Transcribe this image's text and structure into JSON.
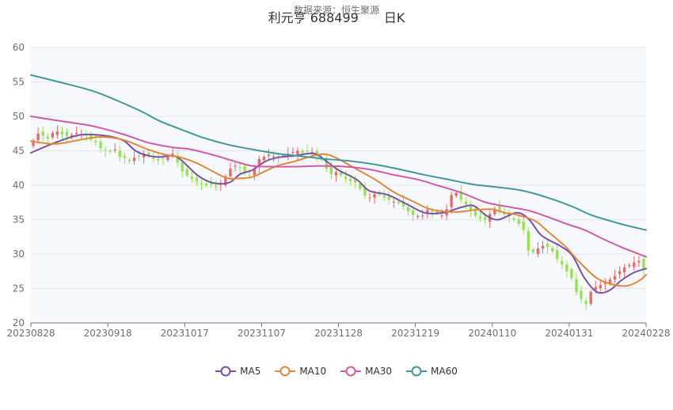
{
  "title": {
    "sub": "数据来源：恒生聚源",
    "main": "利元亨 688499　　日K"
  },
  "colors": {
    "up": "#ee6666",
    "down": "#91e54a",
    "MA5": "#7953a9",
    "MA10": "#e3873a",
    "MA30": "#d459a8",
    "MA60": "#3f9a9b",
    "plotBg": "#f7f8fc",
    "grid": "#e2e6ef"
  },
  "chart_data": {
    "type": "candlestick",
    "ylim": [
      20,
      60
    ],
    "yticks": [
      20,
      25,
      30,
      35,
      40,
      45,
      50,
      55,
      60
    ],
    "xticks": [
      "20230828",
      "20230918",
      "20231017",
      "20231107",
      "20231128",
      "20231219",
      "20240110",
      "20240131",
      "20240228"
    ],
    "x_range": [
      "20230828",
      "20240228"
    ],
    "closes": [
      46.5,
      47.5,
      47.2,
      46.8,
      47.6,
      47.8,
      47.4,
      47.1,
      47.3,
      47.6,
      47.4,
      47.2,
      46.6,
      46.2,
      45.4,
      45.0,
      44.9,
      45.2,
      44.1,
      44.0,
      43.5,
      44.0,
      44.2,
      44.6,
      44.3,
      43.8,
      43.6,
      43.8,
      44.3,
      44.6,
      43.3,
      42.0,
      41.4,
      40.9,
      40.6,
      40.2,
      40.0,
      40.1,
      39.9,
      40.3,
      41.3,
      42.4,
      42.8,
      42.6,
      41.8,
      41.4,
      42.3,
      43.8,
      44.1,
      44.4,
      44.2,
      44.0,
      44.3,
      44.6,
      44.8,
      45.0,
      44.7,
      44.9,
      44.8,
      44.4,
      43.7,
      42.4,
      41.6,
      41.9,
      41.5,
      40.9,
      40.6,
      40.4,
      39.5,
      38.5,
      38.2,
      38.7,
      38.6,
      38.2,
      37.9,
      37.6,
      37.4,
      36.9,
      36.2,
      35.7,
      35.5,
      35.6,
      36.4,
      36.1,
      35.9,
      35.6,
      36.5,
      38.6,
      38.9,
      37.9,
      37.2,
      36.3,
      35.6,
      35.2,
      35.0,
      35.8,
      36.6,
      36.2,
      35.8,
      35.5,
      35.0,
      34.4,
      33.5,
      30.5,
      30.3,
      30.8,
      31.2,
      31.0,
      30.4,
      29.3,
      28.5,
      27.5,
      26.5,
      24.5,
      23.5,
      22.8,
      24.5,
      25.2,
      25.5,
      26.0,
      26.3,
      26.8,
      27.5,
      28.1,
      28.4,
      28.8,
      29.0,
      27.8
    ],
    "series": [
      {
        "name": "MA5",
        "values": [
          [
            0,
            44.7
          ],
          [
            0.04,
            46.2
          ],
          [
            0.08,
            47.3
          ],
          [
            0.12,
            47.2
          ],
          [
            0.15,
            46.5
          ],
          [
            0.17,
            45.0
          ],
          [
            0.19,
            44.3
          ],
          [
            0.21,
            44.1
          ],
          [
            0.23,
            44.3
          ],
          [
            0.245,
            43.6
          ],
          [
            0.27,
            41.5
          ],
          [
            0.29,
            40.5
          ],
          [
            0.31,
            40.2
          ],
          [
            0.325,
            40.5
          ],
          [
            0.34,
            41.6
          ],
          [
            0.36,
            42.2
          ],
          [
            0.38,
            43.4
          ],
          [
            0.4,
            44.0
          ],
          [
            0.43,
            44.3
          ],
          [
            0.46,
            44.6
          ],
          [
            0.48,
            43.5
          ],
          [
            0.5,
            42.2
          ],
          [
            0.53,
            40.8
          ],
          [
            0.55,
            39.2
          ],
          [
            0.58,
            38.6
          ],
          [
            0.61,
            37.3
          ],
          [
            0.64,
            36.0
          ],
          [
            0.67,
            36.0
          ],
          [
            0.7,
            36.8
          ],
          [
            0.72,
            37.0
          ],
          [
            0.74,
            35.6
          ],
          [
            0.76,
            35.0
          ],
          [
            0.79,
            36.0
          ],
          [
            0.81,
            35.0
          ],
          [
            0.83,
            32.7
          ],
          [
            0.86,
            31.2
          ],
          [
            0.88,
            29.8
          ],
          [
            0.9,
            26.5
          ],
          [
            0.92,
            24.5
          ],
          [
            0.94,
            24.7
          ],
          [
            0.96,
            26.2
          ],
          [
            0.98,
            27.3
          ],
          [
            1.0,
            27.9
          ]
        ]
      },
      {
        "name": "MA10",
        "values": [
          [
            0,
            46.4
          ],
          [
            0.04,
            46.0
          ],
          [
            0.08,
            46.6
          ],
          [
            0.11,
            47.0
          ],
          [
            0.14,
            46.8
          ],
          [
            0.16,
            46.3
          ],
          [
            0.19,
            45.2
          ],
          [
            0.22,
            44.4
          ],
          [
            0.245,
            44.0
          ],
          [
            0.27,
            43.2
          ],
          [
            0.3,
            41.8
          ],
          [
            0.32,
            41.0
          ],
          [
            0.34,
            41.0
          ],
          [
            0.36,
            41.2
          ],
          [
            0.38,
            42.0
          ],
          [
            0.4,
            42.8
          ],
          [
            0.43,
            43.5
          ],
          [
            0.46,
            44.3
          ],
          [
            0.48,
            44.5
          ],
          [
            0.5,
            43.8
          ],
          [
            0.53,
            42.3
          ],
          [
            0.56,
            40.8
          ],
          [
            0.59,
            39.0
          ],
          [
            0.62,
            37.7
          ],
          [
            0.65,
            36.5
          ],
          [
            0.69,
            36.1
          ],
          [
            0.72,
            36.4
          ],
          [
            0.75,
            36.5
          ],
          [
            0.77,
            36.0
          ],
          [
            0.79,
            35.7
          ],
          [
            0.82,
            34.8
          ],
          [
            0.84,
            33.3
          ],
          [
            0.87,
            31.0
          ],
          [
            0.89,
            29.0
          ],
          [
            0.92,
            26.5
          ],
          [
            0.95,
            25.5
          ],
          [
            0.97,
            25.4
          ],
          [
            0.99,
            26.2
          ],
          [
            1.0,
            27.0
          ]
        ]
      },
      {
        "name": "MA30",
        "values": [
          [
            0,
            50.0
          ],
          [
            0.05,
            49.3
          ],
          [
            0.1,
            48.6
          ],
          [
            0.15,
            47.4
          ],
          [
            0.19,
            46.2
          ],
          [
            0.23,
            45.5
          ],
          [
            0.26,
            45.2
          ],
          [
            0.3,
            44.3
          ],
          [
            0.33,
            43.5
          ],
          [
            0.36,
            42.8
          ],
          [
            0.39,
            42.7
          ],
          [
            0.43,
            42.7
          ],
          [
            0.47,
            42.8
          ],
          [
            0.51,
            42.7
          ],
          [
            0.55,
            42.3
          ],
          [
            0.59,
            41.5
          ],
          [
            0.63,
            40.8
          ],
          [
            0.66,
            40.0
          ],
          [
            0.7,
            38.9
          ],
          [
            0.74,
            37.5
          ],
          [
            0.78,
            36.8
          ],
          [
            0.81,
            36.3
          ],
          [
            0.84,
            35.4
          ],
          [
            0.87,
            34.4
          ],
          [
            0.9,
            33.5
          ],
          [
            0.93,
            32.2
          ],
          [
            0.96,
            31.0
          ],
          [
            0.98,
            30.3
          ],
          [
            1.0,
            29.6
          ]
        ]
      },
      {
        "name": "MA60",
        "values": [
          [
            0,
            56.0
          ],
          [
            0.05,
            54.9
          ],
          [
            0.1,
            53.7
          ],
          [
            0.14,
            52.3
          ],
          [
            0.18,
            50.7
          ],
          [
            0.21,
            49.3
          ],
          [
            0.25,
            47.9
          ],
          [
            0.28,
            46.9
          ],
          [
            0.32,
            45.9
          ],
          [
            0.36,
            45.2
          ],
          [
            0.4,
            44.6
          ],
          [
            0.44,
            44.2
          ],
          [
            0.48,
            43.8
          ],
          [
            0.52,
            43.5
          ],
          [
            0.56,
            43.0
          ],
          [
            0.6,
            42.3
          ],
          [
            0.64,
            41.5
          ],
          [
            0.68,
            40.8
          ],
          [
            0.72,
            40.1
          ],
          [
            0.76,
            39.7
          ],
          [
            0.8,
            39.2
          ],
          [
            0.84,
            38.2
          ],
          [
            0.88,
            36.9
          ],
          [
            0.91,
            35.7
          ],
          [
            0.95,
            34.6
          ],
          [
            0.98,
            33.9
          ],
          [
            1.0,
            33.5
          ]
        ]
      }
    ],
    "legend": [
      "MA5",
      "MA10",
      "MA30",
      "MA60"
    ],
    "legend_position": "bottom",
    "grid": true
  }
}
